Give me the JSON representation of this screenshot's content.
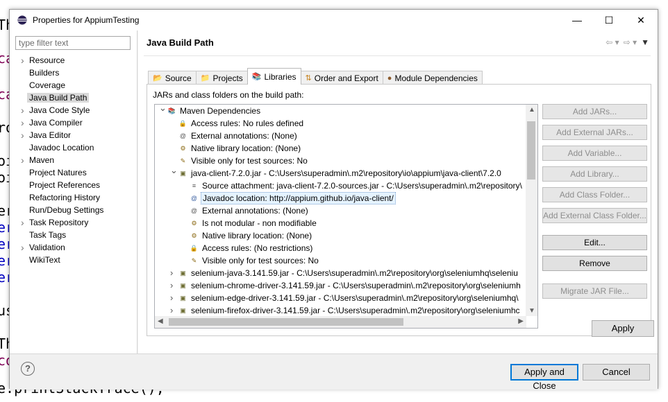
{
  "background_code": [
    {
      "text": "Th",
      "color": "#000000"
    },
    {
      "text": "cat",
      "color": "#7f0055"
    },
    {
      "text": "cat",
      "color": "#7f0055"
    },
    {
      "text": "ro",
      "color": "#000000"
    },
    {
      "text": "oi",
      "color": "#000000"
    },
    {
      "text": "oi",
      "color": "#000000"
    },
    {
      "text": "er",
      "color": "#000000"
    },
    {
      "text": "er",
      "color": "#0000c0"
    },
    {
      "text": "er",
      "color": "#0000c0"
    },
    {
      "text": "er",
      "color": "#0000c0"
    },
    {
      "text": "er",
      "color": "#0000c0"
    },
    {
      "text": "us",
      "color": "#000000"
    },
    {
      "text": "Th",
      "color": "#000000"
    },
    {
      "text": "co",
      "color": "#7f0055"
    },
    {
      "text": "e.printStackTrace();",
      "color": "#000000"
    }
  ],
  "window": {
    "title": "Properties for AppiumTesting",
    "minimize": "—",
    "maximize": "☐",
    "close": "✕"
  },
  "filter": {
    "placeholder": "type filter text"
  },
  "nav_tree": [
    {
      "label": "Resource",
      "expandable": true
    },
    {
      "label": "Builders",
      "expandable": false
    },
    {
      "label": "Coverage",
      "expandable": false
    },
    {
      "label": "Java Build Path",
      "expandable": false,
      "selected": true
    },
    {
      "label": "Java Code Style",
      "expandable": true
    },
    {
      "label": "Java Compiler",
      "expandable": true
    },
    {
      "label": "Java Editor",
      "expandable": true
    },
    {
      "label": "Javadoc Location",
      "expandable": false
    },
    {
      "label": "Maven",
      "expandable": true
    },
    {
      "label": "Project Natures",
      "expandable": false
    },
    {
      "label": "Project References",
      "expandable": false
    },
    {
      "label": "Refactoring History",
      "expandable": false
    },
    {
      "label": "Run/Debug Settings",
      "expandable": false
    },
    {
      "label": "Task Repository",
      "expandable": true
    },
    {
      "label": "Task Tags",
      "expandable": false
    },
    {
      "label": "Validation",
      "expandable": true
    },
    {
      "label": "WikiText",
      "expandable": false
    }
  ],
  "page": {
    "title": "Java Build Path",
    "tabs": [
      "Source",
      "Projects",
      "Libraries",
      "Order and Export",
      "Module Dependencies"
    ],
    "active_tab": "Libraries",
    "jars_label": "JARs and class folders on the build path:"
  },
  "build_tree": [
    {
      "text": "Maven Dependencies",
      "level": 0,
      "twisty": "open",
      "icon": "library-icon"
    },
    {
      "text": "Access rules: No rules defined",
      "level": 1,
      "icon": "access-rules-icon"
    },
    {
      "text": "External annotations: (None)",
      "level": 1,
      "icon": "annotations-icon"
    },
    {
      "text": "Native library location: (None)",
      "level": 1,
      "icon": "native-library-icon"
    },
    {
      "text": "Visible only for test sources: No",
      "level": 1,
      "icon": "test-sources-icon"
    },
    {
      "text": "java-client-7.2.0.jar - C:\\Users\\superadmin\\.m2\\repository\\io\\appium\\java-client\\7.2.0",
      "level": 1,
      "twisty": "open",
      "icon": "jar-icon"
    },
    {
      "text": "Source attachment: java-client-7.2.0-sources.jar - C:\\Users\\superadmin\\.m2\\repository\\",
      "level": 2,
      "icon": "source-attachment-icon"
    },
    {
      "text": "Javadoc location: http://appium.github.io/java-client/",
      "level": 2,
      "icon": "javadoc-icon",
      "highlight": true
    },
    {
      "text": "External annotations: (None)",
      "level": 2,
      "icon": "annotations-icon"
    },
    {
      "text": "Is not modular - non modifiable",
      "level": 2,
      "icon": "module-icon"
    },
    {
      "text": "Native library location: (None)",
      "level": 2,
      "icon": "native-library-icon"
    },
    {
      "text": "Access rules: (No restrictions)",
      "level": 2,
      "icon": "access-rules-icon"
    },
    {
      "text": "Visible only for test sources: No",
      "level": 2,
      "icon": "test-sources-icon"
    },
    {
      "text": "selenium-java-3.141.59.jar - C:\\Users\\superadmin\\.m2\\repository\\org\\seleniumhq\\seleniu",
      "level": 1,
      "twisty": "closed",
      "icon": "jar-icon"
    },
    {
      "text": "selenium-chrome-driver-3.141.59.jar - C:\\Users\\superadmin\\.m2\\repository\\org\\seleniumh",
      "level": 1,
      "twisty": "closed",
      "icon": "jar-icon"
    },
    {
      "text": "selenium-edge-driver-3.141.59.jar - C:\\Users\\superadmin\\.m2\\repository\\org\\seleniumhq\\",
      "level": 1,
      "twisty": "closed",
      "icon": "jar-icon"
    },
    {
      "text": "selenium-firefox-driver-3.141.59.jar - C:\\Users\\superadmin\\.m2\\repository\\org\\seleniumhc",
      "level": 1,
      "twisty": "closed",
      "icon": "jar-icon"
    }
  ],
  "side_buttons": [
    {
      "label": "Add JARs...",
      "enabled": false
    },
    {
      "label": "Add External JARs...",
      "enabled": false
    },
    {
      "label": "Add Variable...",
      "enabled": false
    },
    {
      "label": "Add Library...",
      "enabled": false
    },
    {
      "label": "Add Class Folder...",
      "enabled": false
    },
    {
      "label": "Add External Class Folder...",
      "enabled": false
    },
    {
      "label": "Edit...",
      "enabled": true
    },
    {
      "label": "Remove",
      "enabled": true
    },
    {
      "label": "Migrate JAR File...",
      "enabled": false
    }
  ],
  "buttons": {
    "apply": "Apply",
    "apply_close": "Apply and Close",
    "cancel": "Cancel",
    "help": "?"
  }
}
